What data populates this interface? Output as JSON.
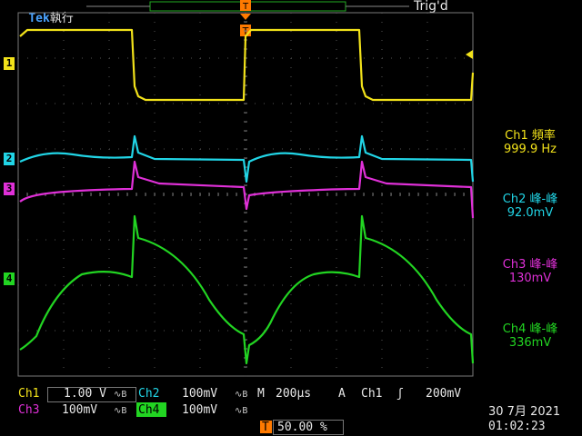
{
  "header": {
    "brand": "Tek",
    "run_state": "執行",
    "trig_status": "Trig'd"
  },
  "channels": [
    {
      "id": "1",
      "color": "#f2e21a"
    },
    {
      "id": "2",
      "color": "#21d5e6"
    },
    {
      "id": "3",
      "color": "#e030d8"
    },
    {
      "id": "4",
      "color": "#22d522"
    }
  ],
  "measurements": [
    {
      "label": "Ch1 頻率",
      "value": "999.9 Hz",
      "color": "#f2e21a"
    },
    {
      "label": "Ch2 峰-峰",
      "value": "92.0mV",
      "color": "#21d5e6"
    },
    {
      "label": "Ch3 峰-峰",
      "value": "130mV",
      "color": "#e030d8"
    },
    {
      "label": "Ch4 峰-峰",
      "value": "336mV",
      "color": "#22d522"
    }
  ],
  "bottom": {
    "ch1_name": "Ch1",
    "ch1_scale": "1.00 V",
    "ch2_name": "Ch2",
    "ch2_scale": "100mV",
    "ch3_name": "Ch3",
    "ch3_scale": "100mV",
    "ch4_name": "Ch4",
    "ch4_scale": "100mV",
    "timebase_label": "M",
    "timebase": "200μs",
    "trig_mode": "A",
    "trig_source": "Ch1",
    "trig_level": "200mV",
    "trig_pos_marker": "T",
    "trig_pos": "50.00 %",
    "date": "30 7月  2021",
    "time": "01:02:23"
  },
  "trigger_marker": "T"
}
